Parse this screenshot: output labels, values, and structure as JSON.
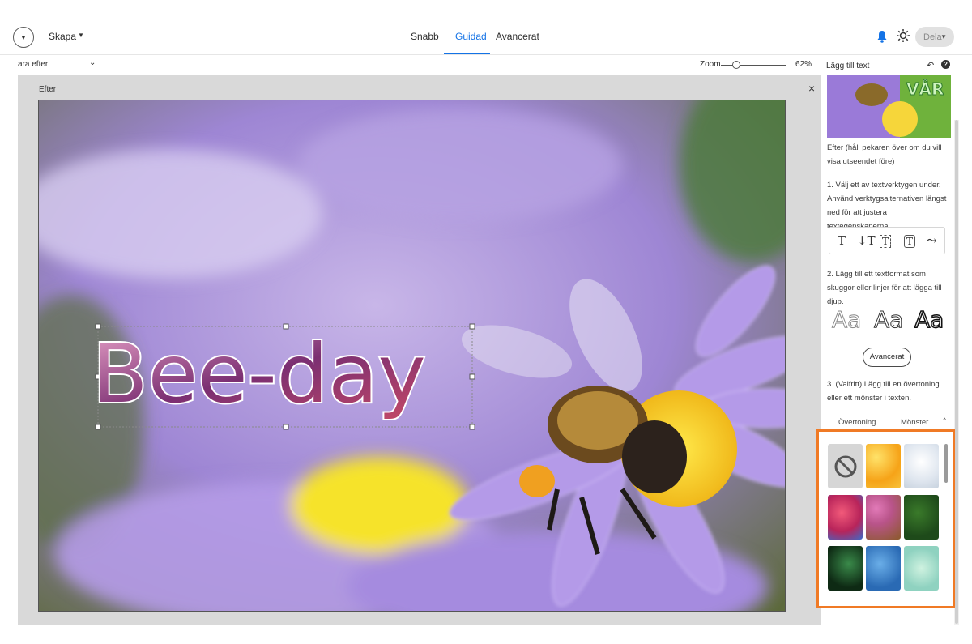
{
  "topbar": {
    "menu_label": "Skapa",
    "tabs": [
      {
        "label": "Snabb",
        "active": false
      },
      {
        "label": "Guidad",
        "active": true
      },
      {
        "label": "Avancerat",
        "active": false
      }
    ],
    "share_label": "Dela"
  },
  "subbar": {
    "view_select": "ara efter",
    "zoom_label": "Zoom",
    "zoom_value": "62%",
    "zoom_level_fraction": 0.2
  },
  "canvas": {
    "label": "Efter",
    "close_label": "×",
    "text_layer": "Bee-day"
  },
  "panel": {
    "title": "Lägg till text",
    "thumb_text": "VÅR",
    "caption": "Efter (håll pekaren över om du vill visa utseendet före)",
    "step1": "1. Välj ett av textverktygen under. Använd verktygsalternativen längst ned för att justera textegenskaperna.",
    "step2": "2. Lägg till ett textformat som skuggor eller linjer för att lägga till djup.",
    "style_samples": [
      "Aa",
      "Aa",
      "Aa"
    ],
    "advanced_button": "Avancerat",
    "step3": "3. (Valfritt) Lägg till en övertoning eller ett mönster i texten.",
    "tabs": [
      {
        "label": "Övertoning",
        "active": false
      },
      {
        "label": "Mönster",
        "active": true
      }
    ]
  },
  "colors": {
    "accent": "#1473e6",
    "highlight": "#f07a25"
  }
}
